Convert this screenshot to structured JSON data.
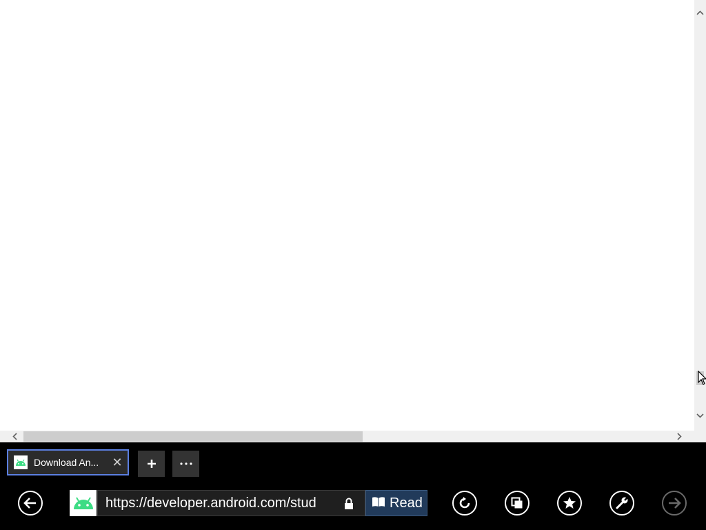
{
  "tab": {
    "title": "Download An...",
    "close_glyph": "✕",
    "favicon": "android-icon"
  },
  "tab_controls": {
    "new_tab_icon": "plus-icon",
    "more_icon": "ellipsis-icon"
  },
  "address_bar": {
    "url": "https://developer.android.com/stud",
    "secure_icon": "lock-icon",
    "site_icon": "android-icon"
  },
  "reading_view": {
    "label": "Read",
    "icon": "book-icon"
  },
  "nav_buttons": [
    "back-icon",
    "refresh-icon",
    "tabs-icon",
    "favorites-icon",
    "tools-icon",
    "forward-icon"
  ],
  "colors": {
    "appbar_bg": "#000000",
    "tab_border": "#5b7fe0",
    "read_bg": "#213a5a",
    "android_green": "#3ddc84"
  }
}
